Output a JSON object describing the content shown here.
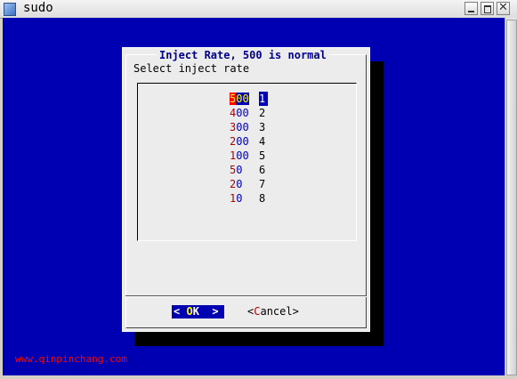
{
  "window": {
    "title": "sudo"
  },
  "dialog": {
    "title": "Inject Rate, 500 is normal",
    "prompt": "Select inject rate",
    "items": [
      {
        "hotkey": "5",
        "rest": "00",
        "tag": "1",
        "selected": true
      },
      {
        "hotkey": "4",
        "rest": "00",
        "tag": "2"
      },
      {
        "hotkey": "3",
        "rest": "00",
        "tag": "3"
      },
      {
        "hotkey": "2",
        "rest": "00",
        "tag": "4"
      },
      {
        "hotkey": "1",
        "rest": "00",
        "tag": "5"
      },
      {
        "hotkey": "5",
        "rest": "0",
        "tag": "6"
      },
      {
        "hotkey": "2",
        "rest": "0",
        "tag": "7"
      },
      {
        "hotkey": "1",
        "rest": "0",
        "tag": "8"
      }
    ],
    "buttons": {
      "ok": {
        "left": "< ",
        "hotkey": "O",
        "rest": "K",
        "right": "  >"
      },
      "cancel": {
        "left": "<",
        "hotkey": "C",
        "rest": "ancel",
        "right": ">"
      }
    }
  },
  "watermark": "www.qinpinchang.com",
  "colors": {
    "terminal_bg": "#0000b3",
    "dialog_bg": "#ececec",
    "hotkey": "#b00000",
    "highlight": "#ffff00",
    "watermark": "#ff0000"
  },
  "icons": {
    "app": "terminal-app-icon",
    "minimize": "minimize-icon",
    "maximize": "maximize-icon",
    "close": "close-icon"
  }
}
